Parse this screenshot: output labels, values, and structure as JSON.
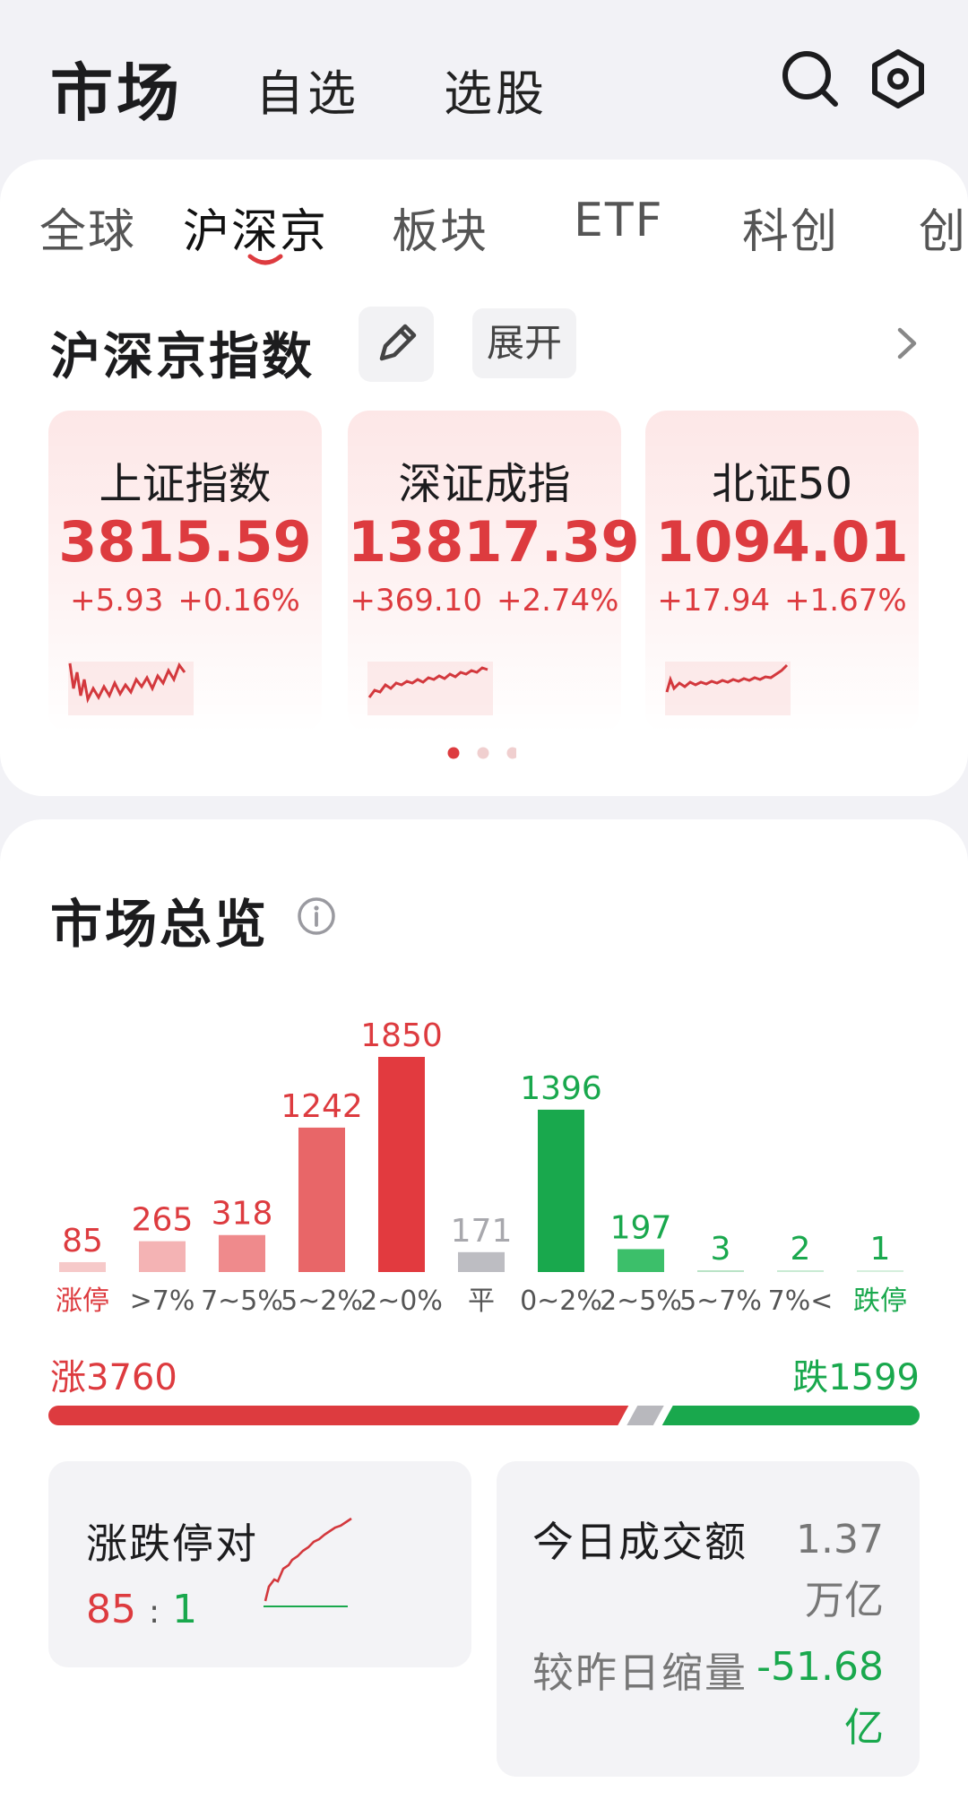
{
  "header": {
    "title": "市场",
    "tabs": [
      "自选",
      "选股"
    ]
  },
  "subtabs": [
    "全球",
    "沪深京",
    "板块",
    "ETF",
    "科创",
    "创"
  ],
  "indices_section": {
    "title": "沪深京指数",
    "expand_label": "展开",
    "pager_active": 0,
    "pager_count": 3,
    "cards": [
      {
        "name": "上证指数",
        "value": "3815.59",
        "change": "+5.93",
        "pct": "+0.16%"
      },
      {
        "name": "深证成指",
        "value": "13817.39",
        "change": "+369.10",
        "pct": "+2.74%"
      },
      {
        "name": "北证50",
        "value": "1094.01",
        "change": "+17.94",
        "pct": "+1.67%"
      }
    ]
  },
  "overview": {
    "title": "市场总览",
    "rise_label": "涨3760",
    "fall_label": "跌1599",
    "rise_count": 3760,
    "flat_count": 171,
    "fall_count": 1599,
    "limit_pair": {
      "title": "涨跌停对",
      "up": "85",
      "sep": ":",
      "down": "1"
    },
    "turnover": {
      "label": "今日成交额",
      "value": "1.37万亿",
      "compare_label": "较昨日缩量",
      "compare_value": "-51.68亿"
    }
  },
  "colors": {
    "up": "#dd3b3f",
    "down": "#19a84d",
    "flat": "#b8b8bd"
  },
  "chart_data": {
    "type": "bar",
    "categories": [
      "涨停",
      ">7%",
      "7~5%",
      "5~2%",
      "2~0%",
      "平",
      "0~2%",
      "2~5%",
      "5~7%",
      "7%<",
      "跌停"
    ],
    "values": [
      85,
      265,
      318,
      1242,
      1850,
      171,
      1396,
      197,
      3,
      2,
      1
    ],
    "bar_colors": [
      "#f6c9c9",
      "#f4b3b4",
      "#ef8a8c",
      "#e86668",
      "#e23a3f",
      "#bdbdc2",
      "#19a84d",
      "#3cbf6a",
      "#b9e3c6",
      "#c9ebd3",
      "#d5efdd"
    ],
    "label_colors": [
      "#dd3b3f",
      "#dd3b3f",
      "#dd3b3f",
      "#dd3b3f",
      "#dd3b3f",
      "#a8a8ad",
      "#19a84d",
      "#19a84d",
      "#19a84d",
      "#19a84d",
      "#19a84d"
    ],
    "category_colors": [
      "#dd3b3f",
      "#555555",
      "#555555",
      "#555555",
      "#555555",
      "#555555",
      "#555555",
      "#555555",
      "#555555",
      "#555555",
      "#19a84d"
    ],
    "title": "",
    "xlabel": "",
    "ylabel": "",
    "ylim": [
      0,
      1850
    ]
  }
}
